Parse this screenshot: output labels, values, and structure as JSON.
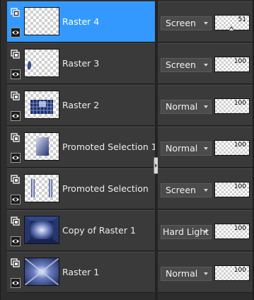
{
  "layers": [
    {
      "name": "Raster 4",
      "blend": "Screen",
      "opacity": "51",
      "opacity_fraction": 0.51,
      "selected": true,
      "thumb": "checker"
    },
    {
      "name": "Raster 3",
      "blend": "Screen",
      "opacity": "100",
      "opacity_fraction": 1.0,
      "selected": false,
      "thumb": "blob"
    },
    {
      "name": "Raster 2",
      "blend": "Normal",
      "opacity": "100",
      "opacity_fraction": 1.0,
      "selected": false,
      "thumb": "grid"
    },
    {
      "name": "Promoted Selection 1",
      "blend": "Normal",
      "opacity": "100",
      "opacity_fraction": 1.0,
      "selected": false,
      "thumb": "square"
    },
    {
      "name": "Promoted Selection",
      "blend": "Screen",
      "opacity": "100",
      "opacity_fraction": 1.0,
      "selected": false,
      "thumb": "bars"
    },
    {
      "name": "Copy of Raster 1",
      "blend": "Hard Light",
      "opacity": "100",
      "opacity_fraction": 1.0,
      "selected": false,
      "thumb": "frame"
    },
    {
      "name": "Raster 1",
      "blend": "Normal",
      "opacity": "100",
      "opacity_fraction": 1.0,
      "selected": false,
      "thumb": "cross"
    }
  ],
  "colors": {
    "selected": "#3399ff",
    "row": "#3a3a3a",
    "panel": "#2d2d2d"
  },
  "icons": {
    "lock": "layer-lock-icon",
    "visibility": "eye-icon"
  }
}
